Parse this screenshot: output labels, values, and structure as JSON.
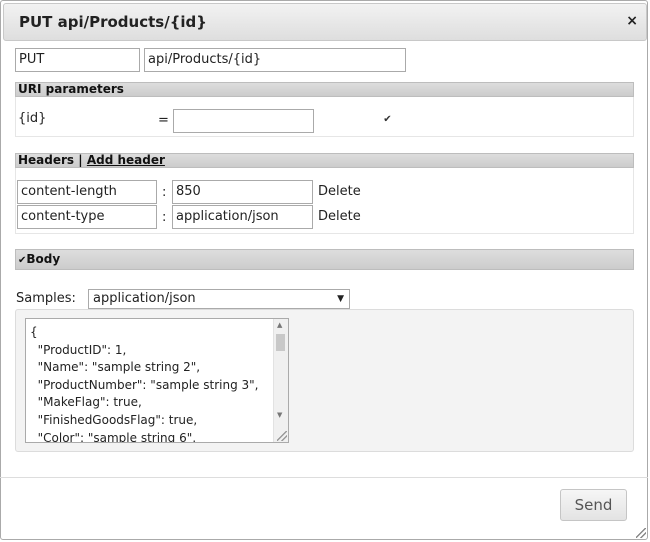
{
  "dialog": {
    "title": "PUT api/Products/{id}",
    "close_icon": "×"
  },
  "request": {
    "method": "PUT",
    "uri": "api/Products/{id}"
  },
  "uri_parameters": {
    "label": "URI parameters",
    "params": [
      {
        "name": "{id}",
        "equals": "=",
        "value": "",
        "checked": true
      }
    ]
  },
  "headers": {
    "label": "Headers",
    "separator": "|",
    "add_label": "Add header",
    "rows": [
      {
        "name": "content-length",
        "colon": ":",
        "value": "850",
        "delete_label": "Delete"
      },
      {
        "name": "content-type",
        "colon": ":",
        "value": "application/json",
        "delete_label": "Delete"
      }
    ]
  },
  "body": {
    "label": "Body",
    "checked": true,
    "samples_label": "Samples:",
    "selected_sample": "application/json",
    "content": "{\n  \"ProductID\": 1,\n  \"Name\": \"sample string 2\",\n  \"ProductNumber\": \"sample string 3\",\n  \"MakeFlag\": true,\n  \"FinishedGoodsFlag\": true,\n  \"Color\": \"sample string 6\","
  },
  "footer": {
    "send_label": "Send"
  }
}
